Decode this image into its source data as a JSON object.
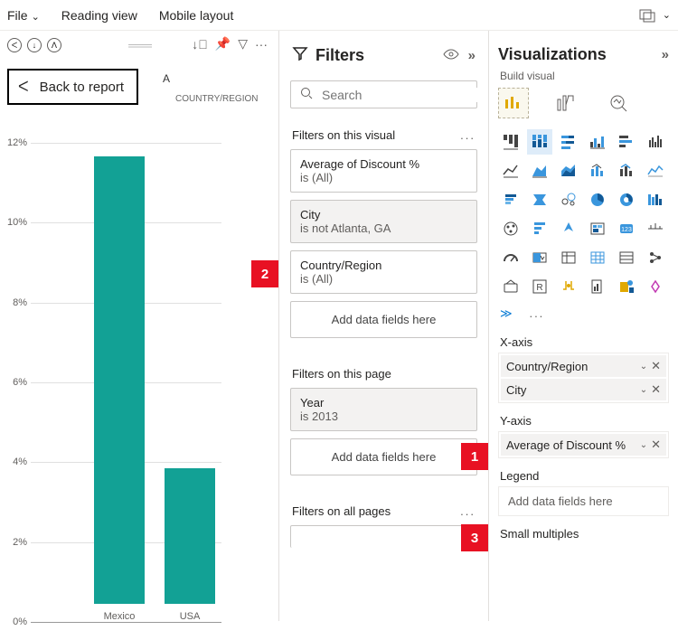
{
  "menu": {
    "file": "File",
    "reading_view": "Reading view",
    "mobile_layout": "Mobile layout"
  },
  "canvas": {
    "back_label": "Back to report",
    "header_frag": "A",
    "header_frag2": "COUNTRY/REGION"
  },
  "chart_data": {
    "type": "bar",
    "categories": [
      "Mexico",
      "USA"
    ],
    "values": [
      11.2,
      3.4
    ],
    "ylabel": "",
    "xlabel": "",
    "ylim": [
      0,
      12
    ],
    "yticks": [
      "0%",
      "2%",
      "4%",
      "6%",
      "8%",
      "10%",
      "12%"
    ]
  },
  "filters": {
    "title": "Filters",
    "search_placeholder": "Search",
    "sections": {
      "visual": {
        "title": "Filters on this visual",
        "cards": [
          {
            "name": "Average of Discount %",
            "value": "is (All)",
            "selected": false
          },
          {
            "name": "City",
            "value": "is not Atlanta, GA",
            "selected": true
          },
          {
            "name": "Country/Region",
            "value": "is (All)",
            "selected": false
          }
        ],
        "add_label": "Add data fields here"
      },
      "page": {
        "title": "Filters on this page",
        "cards": [
          {
            "name": "Year",
            "value": "is 2013",
            "selected": true
          }
        ],
        "add_label": "Add data fields here"
      },
      "all": {
        "title": "Filters on all pages"
      }
    }
  },
  "callouts": {
    "one": "1",
    "two": "2",
    "three": "3"
  },
  "viz": {
    "title": "Visualizations",
    "build_label": "Build visual",
    "sections": {
      "xaxis": {
        "title": "X-axis",
        "pills": [
          "Country/Region",
          "City"
        ]
      },
      "yaxis": {
        "title": "Y-axis",
        "pills": [
          "Average of Discount %"
        ]
      },
      "legend": {
        "title": "Legend",
        "placeholder": "Add data fields here"
      },
      "small_multiples": {
        "title": "Small multiples"
      }
    }
  }
}
